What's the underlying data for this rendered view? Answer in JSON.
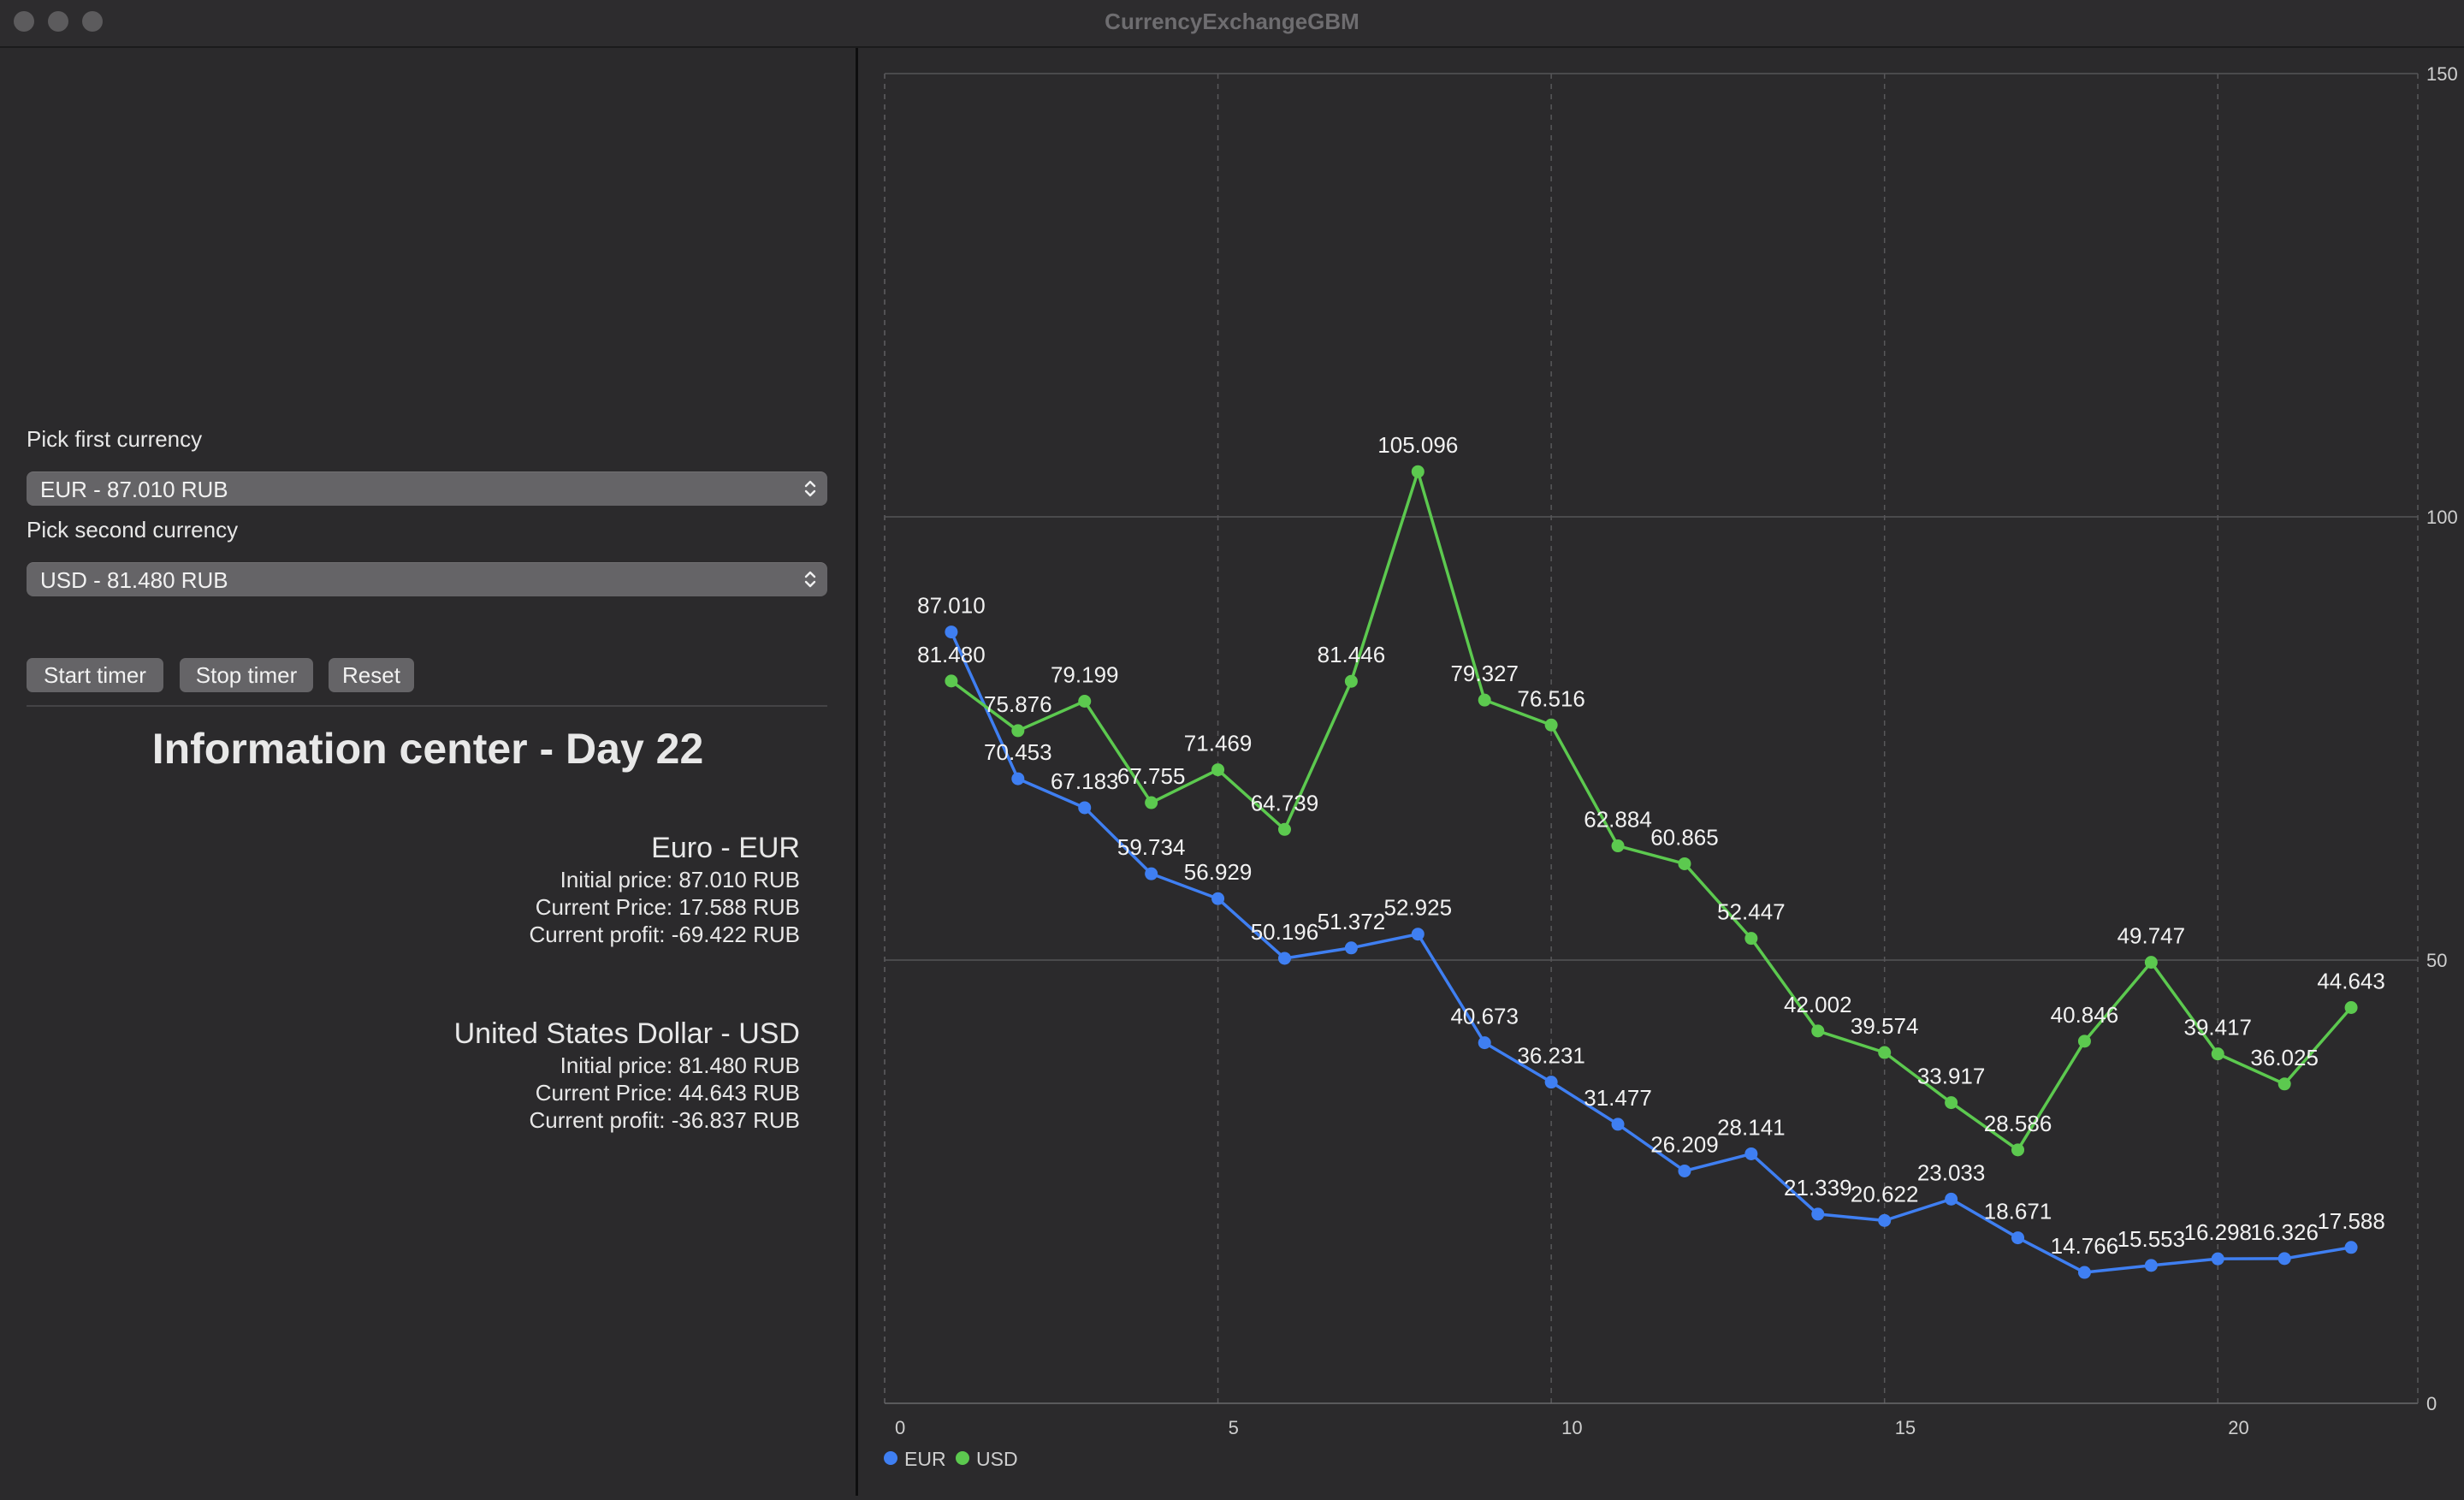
{
  "window": {
    "title": "CurrencyExchangeGBM"
  },
  "controls": {
    "first_label": "Pick first currency",
    "first_value": "EUR - 87.010 RUB",
    "second_label": "Pick second currency",
    "second_value": "USD - 81.480 RUB",
    "start_button": "Start timer",
    "stop_button": "Stop timer",
    "reset_button": "Reset"
  },
  "info": {
    "heading": "Information center - Day 22",
    "eur": {
      "name": "Euro - EUR",
      "initial": "Initial price: 87.010 RUB",
      "current": "Current Price: 17.588 RUB",
      "profit": "Current profit: -69.422 RUB"
    },
    "usd": {
      "name": "United States Dollar - USD",
      "initial": "Initial price: 81.480 RUB",
      "current": "Current Price: 44.643 RUB",
      "profit": "Current profit: -36.837 RUB"
    }
  },
  "chart_data": {
    "type": "line",
    "x": [
      1,
      2,
      3,
      4,
      5,
      6,
      7,
      8,
      9,
      10,
      11,
      12,
      13,
      14,
      15,
      16,
      17,
      18,
      19,
      20,
      21,
      22
    ],
    "xlim": [
      0,
      23
    ],
    "ylim": [
      0,
      150
    ],
    "x_ticks": [
      0,
      5,
      10,
      15,
      20
    ],
    "y_ticks": [
      0,
      50,
      100,
      150
    ],
    "y_axis_side": "right",
    "grid": true,
    "legend": "bottom-left",
    "series": [
      {
        "name": "EUR",
        "color": "#3f7ff2",
        "values": [
          87.01,
          70.453,
          67.183,
          59.734,
          56.929,
          50.196,
          51.372,
          52.925,
          40.673,
          36.231,
          31.477,
          26.209,
          28.141,
          21.339,
          20.622,
          23.033,
          18.671,
          14.766,
          15.553,
          16.298,
          16.326,
          17.588
        ],
        "labels": [
          "87.010",
          "70.453",
          "67.183",
          "59.734",
          "56.929",
          "50.196",
          "51.372",
          "52.925",
          "40.673",
          "36.231",
          "31.477",
          "26.209",
          "28.141",
          "21.339",
          "20.622",
          "23.033",
          "18.671",
          "14.766",
          "15.553",
          "16.298",
          "16.326",
          "17.588"
        ]
      },
      {
        "name": "USD",
        "color": "#5cc94f",
        "values": [
          81.48,
          75.876,
          79.199,
          67.755,
          71.469,
          64.739,
          81.446,
          105.096,
          79.327,
          76.516,
          62.884,
          60.865,
          52.447,
          42.002,
          39.574,
          33.917,
          28.586,
          40.846,
          49.747,
          39.417,
          36.025,
          44.643
        ],
        "labels": [
          "81.480",
          "75.876",
          "79.199",
          "67.755",
          "71.469",
          "64.739",
          "81.446",
          "105.096",
          "79.327",
          "76.516",
          "62.884",
          "60.865",
          "52.447",
          "42.002",
          "39.574",
          "33.917",
          "28.586",
          "40.846",
          "49.747",
          "39.417",
          "36.025",
          "44.643"
        ]
      }
    ]
  }
}
